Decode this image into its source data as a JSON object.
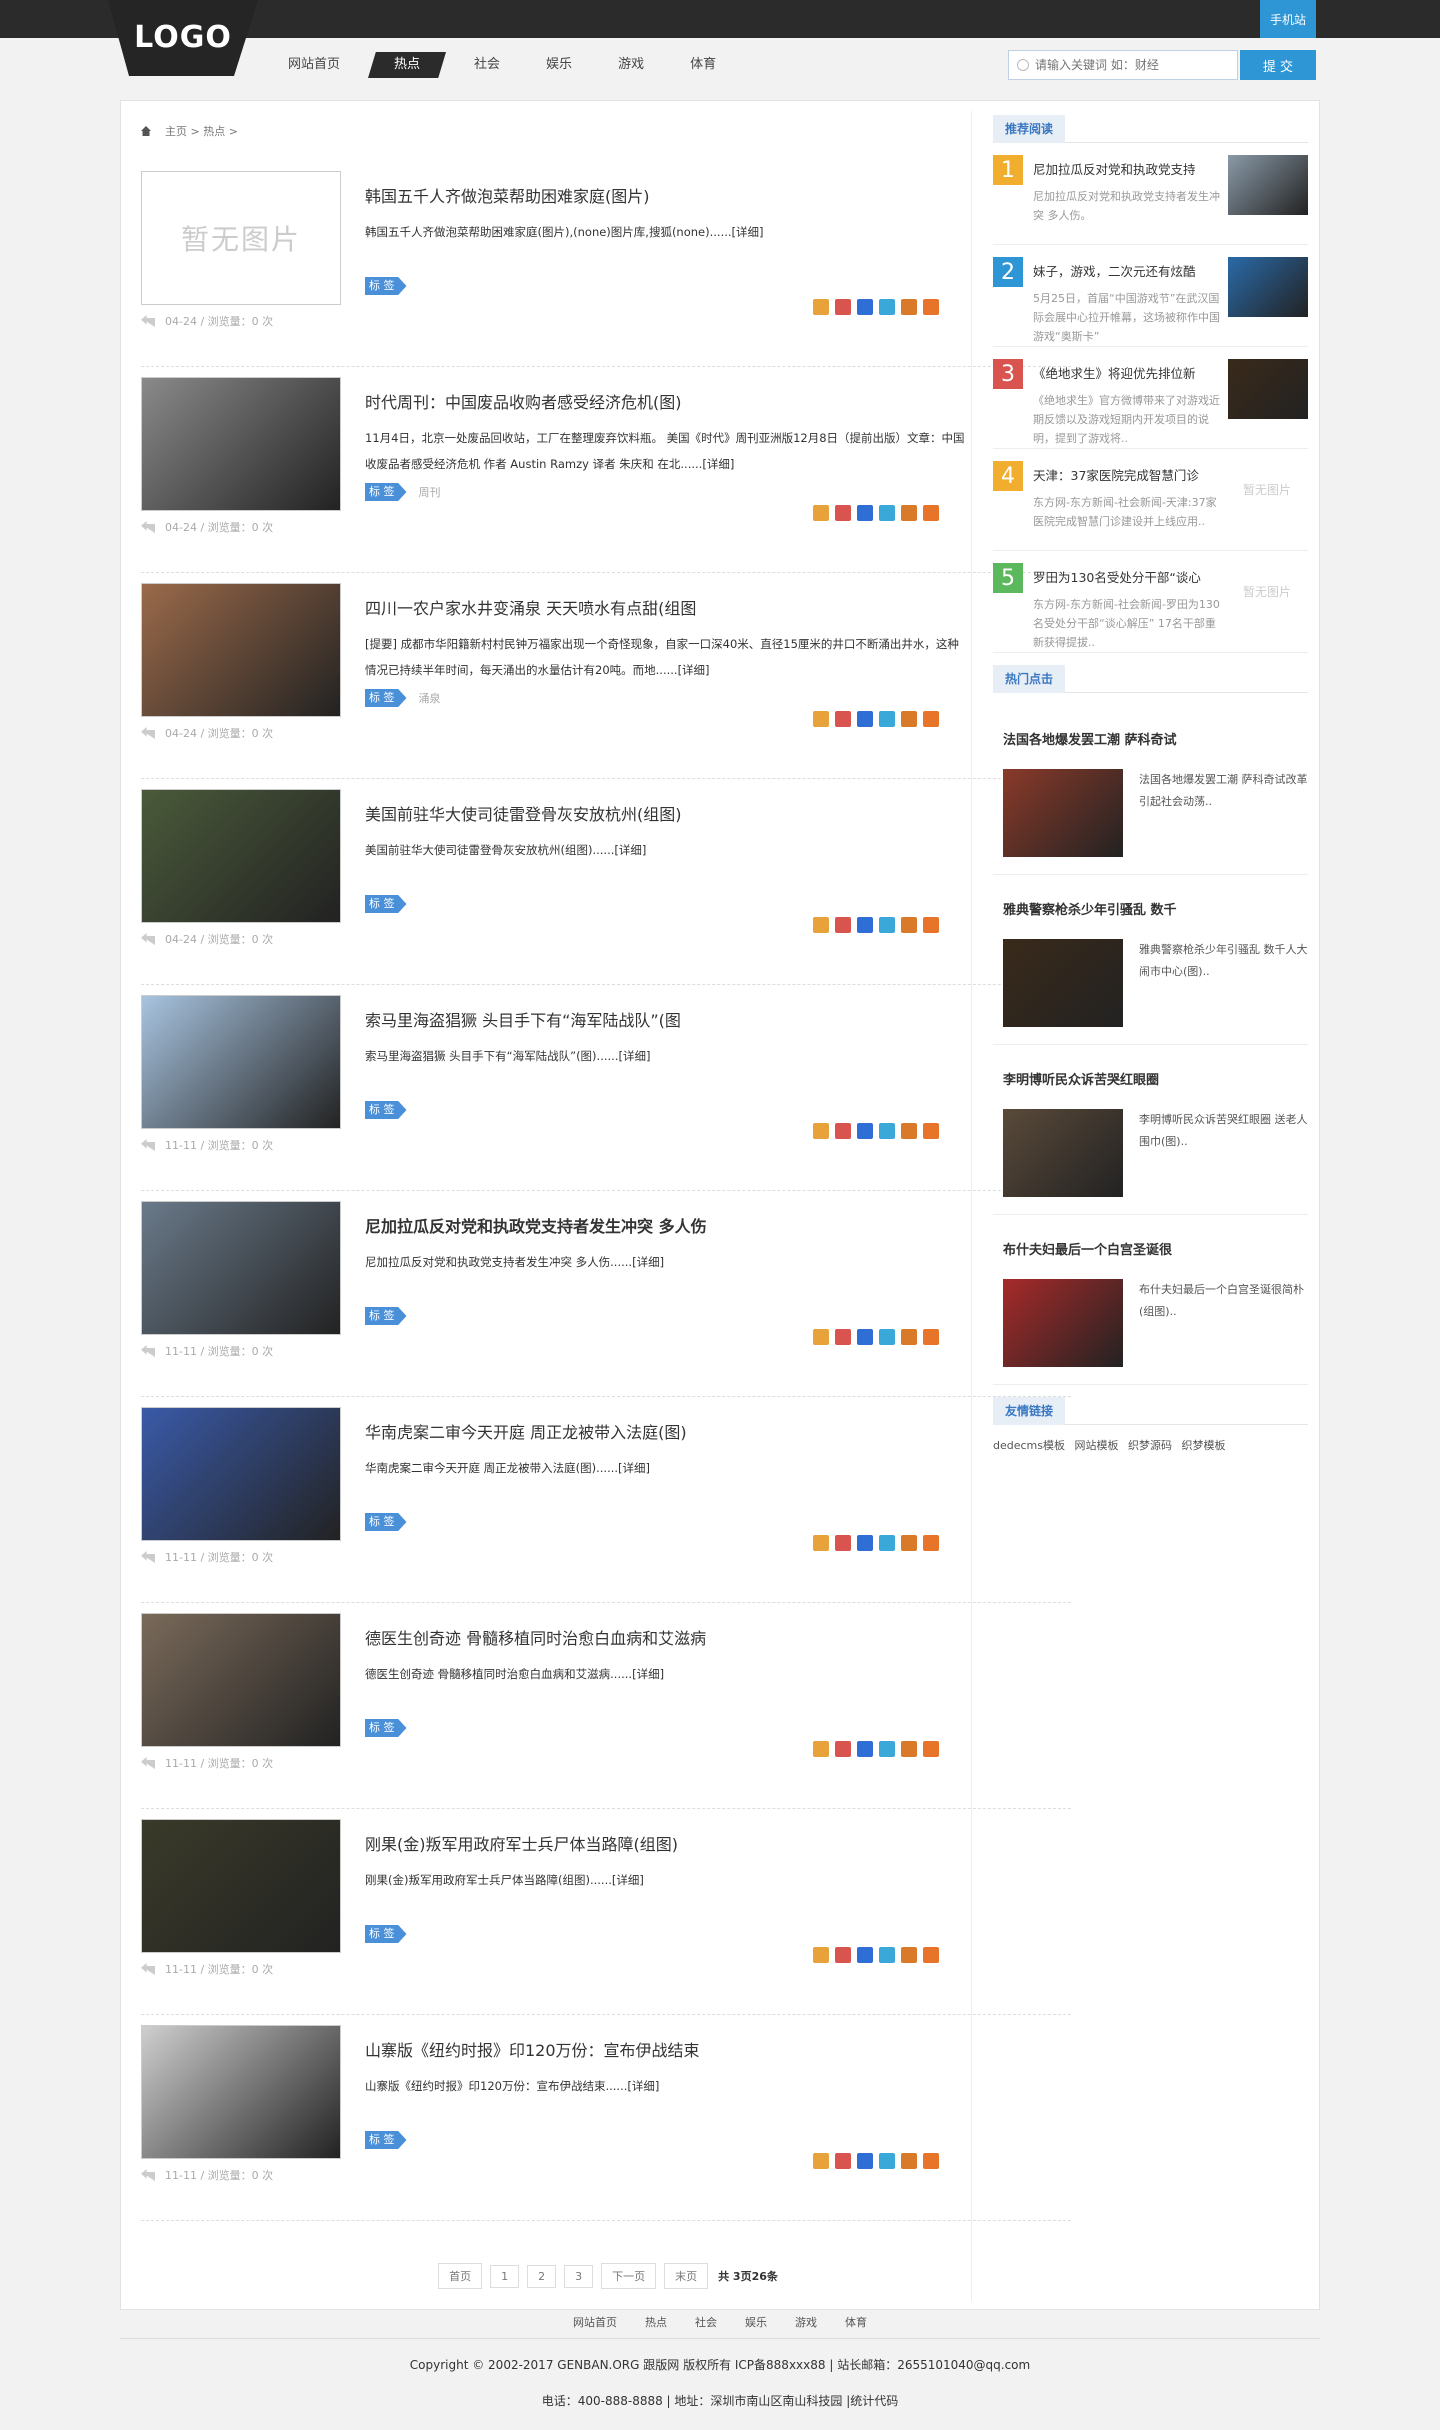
{
  "header": {
    "logo": "LOGO",
    "mobile": "手机站",
    "nav": [
      "网站首页",
      "热点",
      "社会",
      "娱乐",
      "游戏",
      "体育"
    ],
    "search_placeholder": "请输入关键词 如：财经",
    "search_button": "提 交"
  },
  "breadcrumb": "主页 > 热点 >",
  "articles": [
    {
      "title": "韩国五千人齐做泡菜帮助困难家庭(图片)",
      "desc": "韩国五千人齐做泡菜帮助困难家庭(图片),(none)图片库,搜狐(none)......[详细]",
      "tag": "标 签",
      "tagword": "",
      "meta": "04-24 / 浏览量：0 次",
      "noimg": "暂无图片"
    },
    {
      "title": "时代周刊：中国废品收购者感受经济危机(图)",
      "desc": "11月4日，北京一处废品回收站，工厂在整理废弃饮料瓶。 美国《时代》周刊亚洲版12月8日（提前出版）文章：中国收废品者感受经济危机 作者 Austin Ramzy 译者 朱庆和 在北......[详细]",
      "tag": "标 签",
      "tagword": "周刊",
      "meta": "04-24 / 浏览量：0 次"
    },
    {
      "title": "四川一农户家水井变涌泉 天天喷水有点甜(组图",
      "desc": "[提要] 成都市华阳籍新村村民钟万福家出现一个奇怪现象，自家一口深40米、直径15厘米的井口不断涌出井水，这种情况已持续半年时间，每天涌出的水量估计有20吨。而地......[详细]",
      "tag": "标 签",
      "tagword": "涌泉",
      "meta": "04-24 / 浏览量：0 次"
    },
    {
      "title": "美国前驻华大使司徒雷登骨灰安放杭州(组图)",
      "desc": "美国前驻华大使司徒雷登骨灰安放杭州(组图)......[详细]",
      "tag": "标 签",
      "tagword": "",
      "meta": "04-24 / 浏览量：0 次"
    },
    {
      "title": "索马里海盗猖獗 头目手下有“海军陆战队”(图",
      "desc": "索马里海盗猖獗 头目手下有“海军陆战队”(图)......[详细]",
      "tag": "标 签",
      "tagword": "",
      "meta": "11-11 / 浏览量：0 次"
    },
    {
      "title": "尼加拉瓜反对党和执政党支持者发生冲突 多人伤",
      "desc": "尼加拉瓜反对党和执政党支持者发生冲突 多人伤......[详细]",
      "tag": "标 签",
      "tagword": "",
      "meta": "11-11 / 浏览量：0 次"
    },
    {
      "title": "华南虎案二审今天开庭 周正龙被带入法庭(图)",
      "desc": "华南虎案二审今天开庭 周正龙被带入法庭(图)......[详细]",
      "tag": "标 签",
      "tagword": "",
      "meta": "11-11 / 浏览量：0 次"
    },
    {
      "title": "德医生创奇迹 骨髓移植同时治愈白血病和艾滋病",
      "desc": "德医生创奇迹 骨髓移植同时治愈白血病和艾滋病......[详细]",
      "tag": "标 签",
      "tagword": "",
      "meta": "11-11 / 浏览量：0 次"
    },
    {
      "title": "刚果(金)叛军用政府军士兵尸体当路障(组图)",
      "desc": "刚果(金)叛军用政府军士兵尸体当路障(组图)......[详细]",
      "tag": "标 签",
      "tagword": "",
      "meta": "11-11 / 浏览量：0 次"
    },
    {
      "title": "山寨版《纽约时报》印120万份：宣布伊战结束",
      "desc": "山寨版《纽约时报》印120万份：宣布伊战结束......[详细]",
      "tag": "标 签",
      "tagword": "",
      "meta": "11-11 / 浏览量：0 次"
    }
  ],
  "pager": {
    "first": "首页",
    "p1": "1",
    "p2": "2",
    "p3": "3",
    "next": "下一页",
    "last": "末页",
    "total": "共 3页26条"
  },
  "sidebar": {
    "rec_title": "推荐阅读",
    "rec": [
      {
        "num": "1",
        "title": "尼加拉瓜反对党和执政党支持",
        "desc": "尼加拉瓜反对党和执政党支持者发生冲突 多人伤。"
      },
      {
        "num": "2",
        "title": "妹子，游戏，二次元还有炫酷",
        "desc": "5月25日，首届“中国游戏节”在武汉国际会展中心拉开帷幕，这场被称作中国游戏“奥斯卡”"
      },
      {
        "num": "3",
        "title": "《绝地求生》将迎优先排位新",
        "desc": "《绝地求生》官方微博带来了对游戏近期反馈以及游戏短期内开发项目的说明，提到了游戏将.."
      },
      {
        "num": "4",
        "title": "天津：37家医院完成智慧门诊",
        "desc": "东方网-东方新闻-社会新闻-天津:37家医院完成智慧门诊建设并上线应用..",
        "noimg": "暂无图片"
      },
      {
        "num": "5",
        "title": "罗田为130名受处分干部“谈心",
        "desc": "东方网-东方新闻-社会新闻-罗田为130名受处分干部“谈心解压” 17名干部重新获得提拔..",
        "noimg": "暂无图片"
      }
    ],
    "hot_title": "热门点击",
    "hot": [
      {
        "title": "法国各地爆发罢工潮 萨科奇试",
        "desc": "法国各地爆发罢工潮 萨科奇试改革引起社会动荡.."
      },
      {
        "title": "雅典警察枪杀少年引骚乱 数千",
        "desc": "雅典警察枪杀少年引骚乱 数千人大闹市中心(图).."
      },
      {
        "title": "李明博听民众诉苦哭红眼圈",
        "desc": "李明博听民众诉苦哭红眼圈 送老人围巾(图).."
      },
      {
        "title": "布什夫妇最后一个白宫圣诞很",
        "desc": "布什夫妇最后一个白宫圣诞很简朴(组图).."
      }
    ],
    "links_title": "友情链接",
    "links": "dedecms模板 网站模板 织梦源码 织梦模板"
  },
  "footer": {
    "nav": [
      "网站首页",
      "热点",
      "社会",
      "娱乐",
      "游戏",
      "体育"
    ],
    "copyright": "Copyright © 2002-2017 GENBAN.ORG 跟版网 版权所有 ICP备888xxx88 | 站长邮箱：2655101040@qq.com",
    "contact": "电话：400-888-8888 | 地址：深圳市南山区南山科技园 |统计代码"
  },
  "colors": {
    "accent": "#2f96d5",
    "dark": "#2b2b2b",
    "rank1": "#f0ad2e",
    "rank2": "#2f96d5",
    "rank3": "#d9534f",
    "rank4": "#f0ad2e",
    "rank5": "#5cb85c"
  }
}
